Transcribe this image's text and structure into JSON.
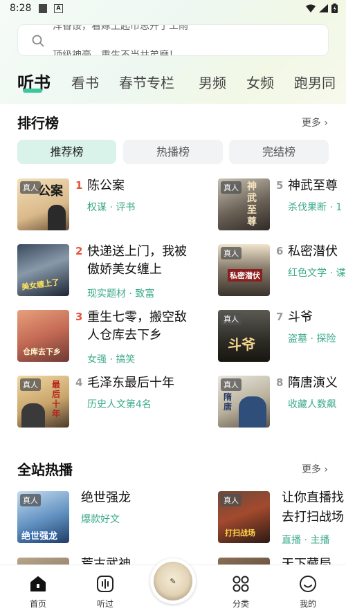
{
  "status_bar": {
    "time": "8:28"
  },
  "search": {
    "hint_line_1": "洋香馁，看嫁上起市思开了工雨",
    "hint_line_2": "顶级神豪，重生不当共弟磨！"
  },
  "tabs": [
    {
      "label": "听书",
      "active": true
    },
    {
      "label": "看书",
      "active": false
    },
    {
      "label": "春节专栏",
      "active": false
    },
    {
      "label": "男频",
      "active": false
    },
    {
      "label": "女频",
      "active": false
    },
    {
      "label": "跑男同",
      "active": false
    }
  ],
  "ranking": {
    "title": "排行榜",
    "more": "更多 ›",
    "pills": [
      {
        "label": "推荐榜",
        "active": true
      },
      {
        "label": "热播榜",
        "active": false
      },
      {
        "label": "完结榜",
        "active": false
      }
    ],
    "items": [
      {
        "rank": "1",
        "title": "陈公案",
        "tags": "权谋 · 评书",
        "badge": "真人",
        "cover_text": "公案"
      },
      {
        "rank": "5",
        "title": "神武至尊",
        "tags": "杀伐果断 · 1",
        "badge": "真人",
        "cover_text": "神武至尊"
      },
      {
        "rank": "2",
        "title": "快递送上门，我被傲娇美女缠上",
        "tags": "现实题材 · 致富",
        "badge": "",
        "cover_text": "美女缠上了"
      },
      {
        "rank": "6",
        "title": "私密潜伏",
        "tags": "红色文学 · 谍",
        "badge": "真人",
        "cover_text": "私密潜伏"
      },
      {
        "rank": "3",
        "title": "重生七零，搬空敌人仓库去下乡",
        "tags": "女强 · 搞笑",
        "badge": "",
        "cover_text": "仓库去下乡"
      },
      {
        "rank": "7",
        "title": "斗爷",
        "tags": "盗墓 · 探险",
        "badge": "真人",
        "cover_text": "斗爷"
      },
      {
        "rank": "4",
        "title": "毛泽东最后十年",
        "tags": "历史人文第4名",
        "badge": "真人",
        "cover_text": "最后十年"
      },
      {
        "rank": "8",
        "title": "隋唐演义",
        "tags": "收藏人数飙",
        "badge": "真人",
        "cover_text": "隋唐"
      }
    ]
  },
  "hot": {
    "title": "全站热播",
    "more": "更多 ›",
    "items": [
      {
        "title": "绝世强龙",
        "tags": "爆款好文",
        "badge": "真人",
        "cover_text": "绝世强龙"
      },
      {
        "title": "让你直播找",
        "title_line2": "去打扫战场",
        "tags": "直播 · 主播",
        "badge": "真人",
        "cover_text": "打扫战场"
      },
      {
        "title": "荒古武神",
        "tags": "",
        "badge": "",
        "cover_text": ""
      },
      {
        "title": "天下藏局",
        "tags": "",
        "badge": "",
        "cover_text": ""
      }
    ]
  },
  "bottom_nav": [
    {
      "label": "首页",
      "icon": "home-icon",
      "active": true
    },
    {
      "label": "听过",
      "icon": "history-audio-icon",
      "active": false
    },
    {
      "label": "",
      "icon": "player-cover",
      "active": false
    },
    {
      "label": "分类",
      "icon": "category-icon",
      "active": false
    },
    {
      "label": "我的",
      "icon": "profile-icon",
      "active": false
    }
  ],
  "colors": {
    "accent": "#3cc7a0",
    "rank_top": "#e5533d",
    "rank_other": "#999999",
    "tag": "#3aa98a"
  }
}
